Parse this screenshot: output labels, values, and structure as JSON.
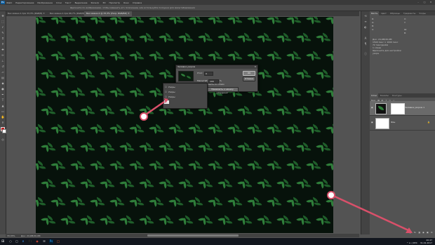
{
  "app": {
    "logo": "Ps",
    "menus": [
      "Файл",
      "Редактирование",
      "Изображение",
      "Слои",
      "Текст",
      "Выделение",
      "Фильтр",
      "3D",
      "Просмотр",
      "Окно",
      "Справка"
    ],
    "window_controls": [
      "–",
      "□",
      "✕"
    ]
  },
  "options_bar": {
    "text": "Щелкните по изображению, чтобы изменить его положение, или используйте ползунки для масштабирования"
  },
  "tabs": [
    {
      "label": "Без имени-1 при 33,3% (RGB/8) ✕",
      "active": false
    },
    {
      "label": "Без имени-1 при 66,7% (RGB/8) ✕",
      "active": false
    },
    {
      "label": "Без имени-2 @ 33,3% (Узор, RGB/8#) ✕",
      "active": true
    }
  ],
  "status": {
    "zoom": "33,33%",
    "doc": "Док: 24,9M/20,0M"
  },
  "panels": {
    "top_tabs": [
      "Кисть",
      "Цвет",
      "Образцы",
      "Градиенты",
      "Узоры"
    ],
    "nav_labels": {
      "r": "R:",
      "g": "G:",
      "b": "B:",
      "x": "X:",
      "y": "Y:",
      "w": "Ш:",
      "h": "В:",
      "a": "A:"
    },
    "info_lines": [
      "Док: 24,9M/20,0M",
      "1500 пикс × 1000 пикс",
      "72 пикс/дюйм",
      "1 слоев",
      "Щелкните для настройки",
      "узора"
    ],
    "layers_tabs": [
      "Слои",
      "Каналы",
      "Контуры"
    ],
    "layers_tools": [
      "Вид",
      "▦",
      "◐",
      "T",
      "▭",
      "◇"
    ],
    "blend_mode": "Обычные",
    "opacity_label": "Непрозр.: 100%",
    "fill_label": "Заливка: 100%",
    "layers": [
      {
        "name": "Заливка узором 1",
        "selected": true
      },
      {
        "name": "Фон",
        "selected": false
      }
    ],
    "footer_icons": [
      "🔗",
      "fx",
      "◨",
      "◉",
      "▣",
      "⧉",
      "🗑"
    ]
  },
  "dialog": {
    "title": "Заливка узором",
    "close": "✕",
    "angle_label": "Угол:",
    "angle_value": "0",
    "scale_label": "Масштаб:",
    "scale_value": "100",
    "scale_unit": "%",
    "ok": "OK",
    "cancel": "Отмена",
    "checkbox_label": "Связать со слоем",
    "snap_button": "Привязать к началу координат"
  },
  "dropdown": {
    "items": [
      {
        "check": "☐",
        "label": "Узоры"
      },
      {
        "check": "☐",
        "label": "Узоры"
      },
      {
        "check": "☐",
        "label": "Узоры"
      }
    ],
    "selected_swatch": "▫"
  },
  "taskbar": {
    "start": "⊞",
    "icons": [
      "○",
      "▢",
      "e",
      "🗀",
      "◉",
      "✉",
      "Ps",
      "◯"
    ],
    "tray": "^ ⌂ ◁ РУС",
    "time": "20:47",
    "date": "31.01.2017"
  },
  "colors": {
    "accent_arrow": "#d9506a",
    "foreground": "#c41d1d",
    "background": "#ffffff",
    "ps_blue": "#0f5e9c"
  }
}
